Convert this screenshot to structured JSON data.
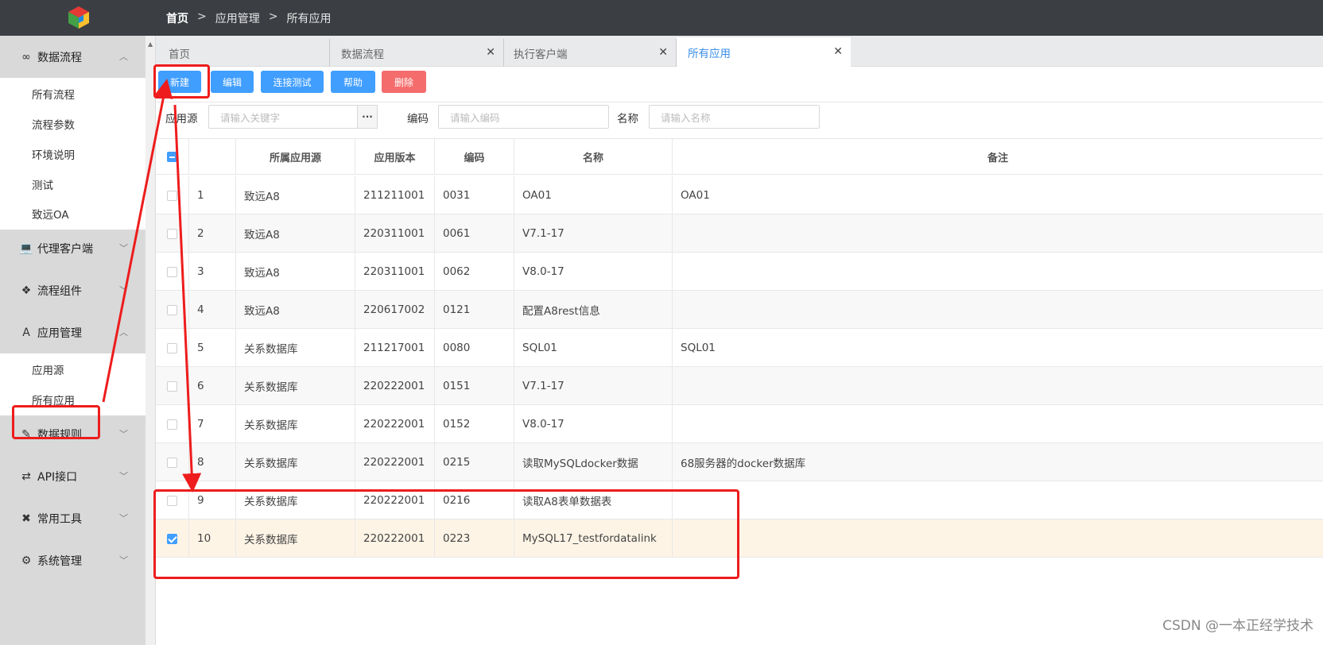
{
  "breadcrumb": {
    "home": "首页",
    "sep": ">",
    "level1": "应用管理",
    "level2": "所有应用"
  },
  "sidebar": {
    "groups": [
      {
        "label": "数据流程",
        "icon": "infinity-icon",
        "expanded": true,
        "items": [
          "所有流程",
          "流程参数",
          "环境说明",
          "测试",
          "致远OA"
        ]
      },
      {
        "label": "代理客户端",
        "icon": "laptop-icon"
      },
      {
        "label": "流程组件",
        "icon": "cubes-icon"
      },
      {
        "label": "应用管理",
        "icon": "letter-a-icon",
        "expanded": true,
        "items": [
          "应用源",
          "所有应用"
        ]
      },
      {
        "label": "数据规则",
        "icon": "pencil-icon"
      },
      {
        "label": "API接口",
        "icon": "swap-arrows-icon"
      },
      {
        "label": "常用工具",
        "icon": "tools-icon"
      },
      {
        "label": "系统管理",
        "icon": "gear-icon"
      }
    ],
    "active_item": "所有应用"
  },
  "tabs": [
    {
      "label": "首页",
      "closable": false
    },
    {
      "label": "数据流程",
      "closable": true
    },
    {
      "label": "执行客户端",
      "closable": true
    },
    {
      "label": "所有应用",
      "closable": true,
      "active": true
    }
  ],
  "toolbar": {
    "new": "新建",
    "edit": "编辑",
    "test": "连接测试",
    "help": "帮助",
    "delete": "删除"
  },
  "search": {
    "source_label": "应用源",
    "source_placeholder": "请输入关键字",
    "dots": "···",
    "code_label": "编码",
    "code_placeholder": "请输入编码",
    "name_label": "名称",
    "name_placeholder": "请输入名称"
  },
  "table": {
    "headers": [
      "",
      "",
      "所属应用源",
      "应用版本",
      "编码",
      "名称",
      "备注"
    ],
    "rows": [
      {
        "no": "1",
        "source": "致远A8",
        "version": "211211001",
        "code": "0031",
        "name": "OA01",
        "remark": "OA01",
        "checked": false
      },
      {
        "no": "2",
        "source": "致远A8",
        "version": "220311001",
        "code": "0061",
        "name": "V7.1-17",
        "remark": "",
        "checked": false
      },
      {
        "no": "3",
        "source": "致远A8",
        "version": "220311001",
        "code": "0062",
        "name": "V8.0-17",
        "remark": "",
        "checked": false
      },
      {
        "no": "4",
        "source": "致远A8",
        "version": "220617002",
        "code": "0121",
        "name": "配置A8rest信息",
        "remark": "",
        "checked": false
      },
      {
        "no": "5",
        "source": "关系数据库",
        "version": "211217001",
        "code": "0080",
        "name": "SQL01",
        "remark": "SQL01",
        "checked": false
      },
      {
        "no": "6",
        "source": "关系数据库",
        "version": "220222001",
        "code": "0151",
        "name": "V7.1-17",
        "remark": "",
        "checked": false
      },
      {
        "no": "7",
        "source": "关系数据库",
        "version": "220222001",
        "code": "0152",
        "name": "V8.0-17",
        "remark": "",
        "checked": false
      },
      {
        "no": "8",
        "source": "关系数据库",
        "version": "220222001",
        "code": "0215",
        "name": "读取MySQLdocker数据",
        "remark": "68服务器的docker数据库",
        "checked": false
      },
      {
        "no": "9",
        "source": "关系数据库",
        "version": "220222001",
        "code": "0216",
        "name": "读取A8表单数据表",
        "remark": "",
        "checked": false
      },
      {
        "no": "10",
        "source": "关系数据库",
        "version": "220222001",
        "code": "0223",
        "name": "MySQL17_testfordatalink",
        "remark": "",
        "checked": true
      }
    ]
  },
  "watermark": "CSDN @一本正经学技术",
  "colors": {
    "primary": "#409eff",
    "danger": "#f56c6c",
    "annotation": "#ee1c1c",
    "topbar": "#3b3f44",
    "sidebar": "#d9d9d9"
  }
}
